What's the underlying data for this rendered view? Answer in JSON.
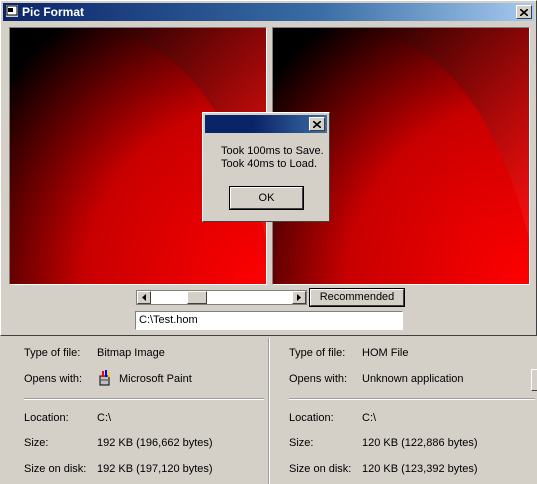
{
  "window": {
    "title": "Pic Format"
  },
  "scrollbar": {
    "position": 0.3
  },
  "controls": {
    "recommended_label": "Recommended",
    "path_value": "C:\\Test.hom"
  },
  "dialog": {
    "line1": "Took 100ms to Save.",
    "line2": "Took 40ms to Load.",
    "ok_label": "OK"
  },
  "labels": {
    "type": "Type of file:",
    "opens": "Opens with:",
    "location": "Location:",
    "size": "Size:",
    "size_on_disk": "Size on disk:"
  },
  "left_file": {
    "type": "Bitmap Image",
    "opens_with": "Microsoft Paint",
    "location": "C:\\",
    "size": "192 KB (196,662 bytes)",
    "size_on_disk": "192 KB (197,120 bytes)"
  },
  "right_file": {
    "type": "HOM File",
    "opens_with": "Unknown application",
    "location": "C:\\",
    "size": "120 KB (122,886 bytes)",
    "size_on_disk": "120 KB (123,392 bytes)"
  },
  "colors": {
    "titlebar": "#0a246a",
    "face": "#d4d0c8",
    "image_red": "#ff0000"
  }
}
